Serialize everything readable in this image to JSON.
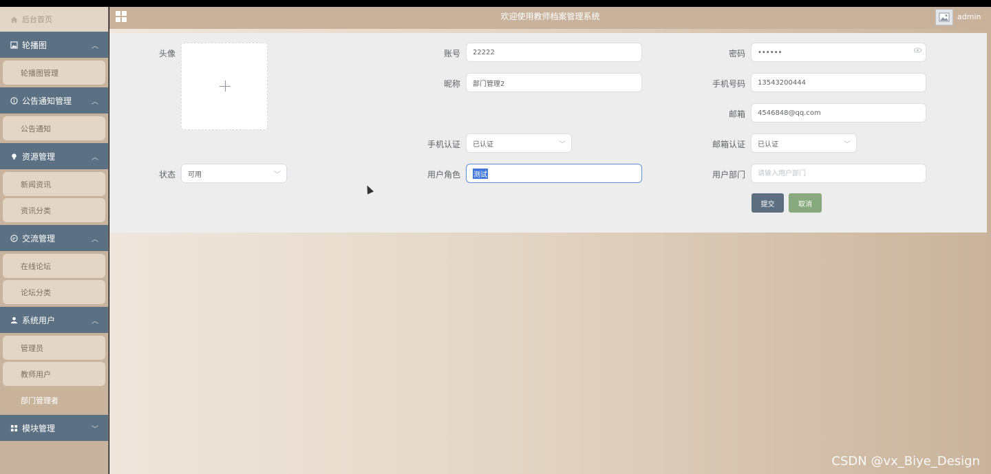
{
  "header": {
    "title": "欢迎使用教师档案管理系统",
    "user": "admin"
  },
  "sidebar": {
    "home": "后台首页",
    "groups": [
      {
        "title": "轮播图",
        "items": [
          "轮播图管理"
        ]
      },
      {
        "title": "公告通知管理",
        "items": [
          "公告通知"
        ]
      },
      {
        "title": "资源管理",
        "items": [
          "新闻资讯",
          "资讯分类"
        ]
      },
      {
        "title": "交流管理",
        "items": [
          "在线论坛",
          "论坛分类"
        ]
      },
      {
        "title": "系统用户",
        "items": [
          "管理员",
          "教师用户",
          "部门管理者"
        ]
      },
      {
        "title": "模块管理",
        "items": []
      }
    ]
  },
  "form": {
    "avatar_label": "头像",
    "account_label": "账号",
    "account_value": "22222",
    "password_label": "密码",
    "password_value": "••••••",
    "nickname_label": "昵称",
    "nickname_value": "部门管理2",
    "phone_label": "手机号码",
    "phone_value": "13543200444",
    "email_label": "邮箱",
    "email_value": "4546848@qq.com",
    "phone_auth_label": "手机认证",
    "phone_auth_value": "已认证",
    "email_auth_label": "邮箱认证",
    "email_auth_value": "已认证",
    "status_label": "状态",
    "status_value": "可用",
    "role_label": "用户角色",
    "role_value": "测试",
    "dept_label": "用户部门",
    "dept_placeholder": "请输入用户部门",
    "submit_label": "提交",
    "cancel_label": "取消"
  },
  "watermark": "CSDN @vx_Biye_Design",
  "colors": {
    "sidebar_head": "#5b7082",
    "header": "#c8b29b",
    "submit": "#5c6e7f",
    "cancel": "#87a97d"
  }
}
